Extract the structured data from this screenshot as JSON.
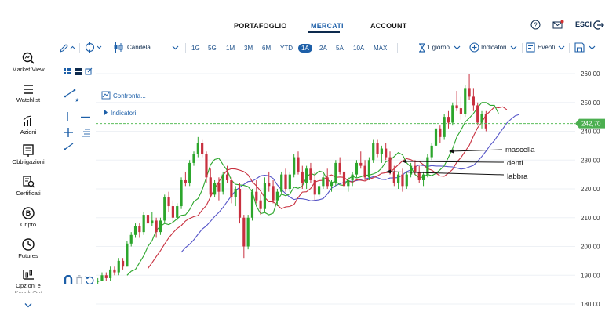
{
  "nav": {
    "portfolio": "PORTAFOGLIO",
    "markets": "MERCATI",
    "account": "ACCOUNT",
    "logout": "ESCI"
  },
  "sidebar": [
    {
      "label": "Market View",
      "icon": "magnifier-chart-icon"
    },
    {
      "label": "Watchlist",
      "icon": "list-icon"
    },
    {
      "label": "Azioni",
      "icon": "bar-chart-icon"
    },
    {
      "label": "Obbligazioni",
      "icon": "document-icon"
    },
    {
      "label": "Certificati",
      "icon": "certificate-icon"
    },
    {
      "label": "Cripto",
      "icon": "bitcoin-icon"
    },
    {
      "label": "Futures",
      "icon": "clock-icon"
    },
    {
      "label": "Opzioni e",
      "label2": "Knock Out",
      "icon": "leverage-icon"
    }
  ],
  "toolbar": {
    "chart_type": "Candela",
    "ranges": [
      "1G",
      "5G",
      "1M",
      "3M",
      "6M",
      "YTD",
      "1A",
      "2A",
      "5A",
      "10A",
      "MAX"
    ],
    "active_range": "1A",
    "interval": "1 giorno",
    "indicators": "Indicatori",
    "events": "Eventi"
  },
  "chart_links": {
    "compare": "Confronta...",
    "indicators": "Indicatori"
  },
  "chart_data": {
    "type": "candlestick",
    "y_ticks": [
      "260,00",
      "250,00",
      "240,00",
      "230,00",
      "220,00",
      "210,00",
      "200,00",
      "190,00",
      "180,00"
    ],
    "ylim": [
      180,
      260
    ],
    "current_price": "242,70",
    "current_price_value": 242.7,
    "colors": {
      "up": "#2ca62c",
      "down": "#c8303f",
      "jaw": "#5555c8",
      "teeth": "#c8303f",
      "lips": "#2ca62c",
      "price_line": "#5cbf5c",
      "price_badge": "#4caf50"
    },
    "annotations": [
      "mascella",
      "denti",
      "labbra"
    ],
    "candles": [
      [
        188,
        189,
        187,
        188
      ],
      [
        188,
        191,
        188,
        190
      ],
      [
        190,
        191,
        188,
        189
      ],
      [
        189,
        193,
        188,
        192
      ],
      [
        192,
        193,
        190,
        191
      ],
      [
        191,
        196,
        190,
        195
      ],
      [
        195,
        196,
        192,
        193
      ],
      [
        193,
        202,
        193,
        201
      ],
      [
        201,
        205,
        200,
        204
      ],
      [
        204,
        208,
        203,
        207
      ],
      [
        207,
        208,
        203,
        205
      ],
      [
        205,
        212,
        204,
        211
      ],
      [
        211,
        212,
        206,
        208
      ],
      [
        208,
        212,
        207,
        209
      ],
      [
        209,
        210,
        203,
        205
      ],
      [
        205,
        210,
        204,
        209
      ],
      [
        209,
        218,
        208,
        217
      ],
      [
        217,
        219,
        212,
        214
      ],
      [
        214,
        216,
        208,
        210
      ],
      [
        210,
        215,
        209,
        214
      ],
      [
        214,
        224,
        213,
        223
      ],
      [
        223,
        226,
        221,
        222
      ],
      [
        222,
        230,
        221,
        229
      ],
      [
        229,
        233,
        228,
        232
      ],
      [
        232,
        238,
        231,
        236
      ],
      [
        236,
        237,
        231,
        232
      ],
      [
        232,
        233,
        222,
        224
      ],
      [
        224,
        227,
        217,
        218
      ],
      [
        218,
        223,
        217,
        222
      ],
      [
        222,
        224,
        216,
        219
      ],
      [
        219,
        226,
        218,
        225
      ],
      [
        225,
        228,
        222,
        223
      ],
      [
        223,
        224,
        215,
        217
      ],
      [
        217,
        221,
        214,
        220
      ],
      [
        220,
        222,
        208,
        210
      ],
      [
        210,
        211,
        196,
        200
      ],
      [
        200,
        211,
        199,
        210
      ],
      [
        210,
        220,
        209,
        219
      ],
      [
        219,
        223,
        215,
        216
      ],
      [
        216,
        218,
        211,
        213
      ],
      [
        213,
        224,
        212,
        222
      ],
      [
        222,
        226,
        219,
        221
      ],
      [
        221,
        223,
        215,
        216
      ],
      [
        216,
        220,
        214,
        219
      ],
      [
        219,
        226,
        218,
        225
      ],
      [
        225,
        227,
        219,
        220
      ],
      [
        220,
        226,
        219,
        225
      ],
      [
        225,
        232,
        224,
        231
      ],
      [
        231,
        233,
        225,
        226
      ],
      [
        226,
        228,
        220,
        222
      ],
      [
        222,
        228,
        220,
        227
      ],
      [
        227,
        229,
        222,
        223
      ],
      [
        223,
        226,
        216,
        218
      ],
      [
        218,
        222,
        217,
        221
      ],
      [
        221,
        225,
        220,
        224
      ],
      [
        224,
        227,
        220,
        221
      ],
      [
        221,
        223,
        219,
        222
      ],
      [
        222,
        230,
        221,
        229
      ],
      [
        229,
        231,
        225,
        226
      ],
      [
        226,
        227,
        220,
        221
      ],
      [
        221,
        224,
        219,
        223
      ],
      [
        223,
        226,
        221,
        225
      ],
      [
        225,
        230,
        224,
        229
      ],
      [
        229,
        233,
        227,
        228
      ],
      [
        228,
        230,
        223,
        224
      ],
      [
        224,
        231,
        223,
        230
      ],
      [
        230,
        237,
        229,
        236
      ],
      [
        236,
        237,
        231,
        232
      ],
      [
        232,
        235,
        229,
        234
      ],
      [
        234,
        236,
        230,
        231
      ],
      [
        231,
        233,
        225,
        226
      ],
      [
        226,
        228,
        221,
        222
      ],
      [
        222,
        226,
        220,
        225
      ],
      [
        225,
        227,
        219,
        221
      ],
      [
        221,
        226,
        220,
        225
      ],
      [
        225,
        229,
        224,
        228
      ],
      [
        228,
        230,
        225,
        226
      ],
      [
        226,
        228,
        222,
        223
      ],
      [
        223,
        226,
        221,
        225
      ],
      [
        225,
        232,
        224,
        231
      ],
      [
        231,
        236,
        230,
        235
      ],
      [
        235,
        242,
        234,
        241
      ],
      [
        241,
        242,
        236,
        238
      ],
      [
        238,
        246,
        237,
        245
      ],
      [
        245,
        247,
        241,
        243
      ],
      [
        243,
        250,
        242,
        249
      ],
      [
        249,
        254,
        247,
        248
      ],
      [
        248,
        252,
        244,
        246
      ],
      [
        246,
        256,
        245,
        255
      ],
      [
        255,
        260,
        251,
        252
      ],
      [
        252,
        255,
        247,
        249
      ],
      [
        249,
        250,
        242,
        243
      ],
      [
        243,
        247,
        241,
        246
      ],
      [
        246,
        247,
        240,
        241
      ]
    ]
  }
}
